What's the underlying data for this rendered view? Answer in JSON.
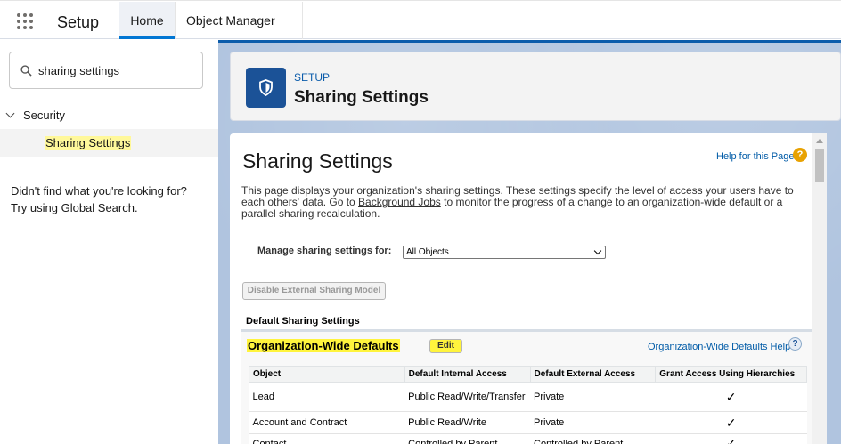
{
  "topbar": {
    "app_name": "Setup",
    "tabs": [
      {
        "label": "Home"
      },
      {
        "label": "Object Manager"
      }
    ]
  },
  "sidebar": {
    "search_value": "sharing settings",
    "tree": {
      "parent": "Security",
      "child": "Sharing Settings"
    },
    "not_found_line1": "Didn't find what you're looking for?",
    "not_found_line2": "Try using Global Search."
  },
  "header": {
    "eyebrow": "SETUP",
    "title": "Sharing Settings"
  },
  "content": {
    "title": "Sharing Settings",
    "help_link": "Help for this Page",
    "description_pre": "This page displays your organization's sharing settings. These settings specify the level of access your users have to each others' data. Go to ",
    "description_link": "Background Jobs",
    "description_post": " to monitor the progress of a change to an organization-wide default or a parallel sharing recalculation.",
    "manage_label": "Manage sharing settings for:",
    "manage_value": "All Objects",
    "disable_button": "Disable External Sharing Model",
    "section_label": "Default Sharing Settings",
    "owd": {
      "title": "Organization-Wide Defaults",
      "edit_label": "Edit",
      "help_link": "Organization-Wide Defaults Help",
      "columns": [
        "Object",
        "Default Internal Access",
        "Default External Access",
        "Grant Access Using Hierarchies"
      ],
      "rows": [
        {
          "object": "Lead",
          "internal": "Public Read/Write/Transfer",
          "external": "Private",
          "grant": "✓"
        },
        {
          "object": "Account and Contract",
          "internal": "Public Read/Write",
          "external": "Private",
          "grant": "✓"
        },
        {
          "object": "Contact",
          "internal": "Controlled by Parent",
          "external": "Controlled by Parent",
          "grant": "✓"
        }
      ]
    }
  }
}
